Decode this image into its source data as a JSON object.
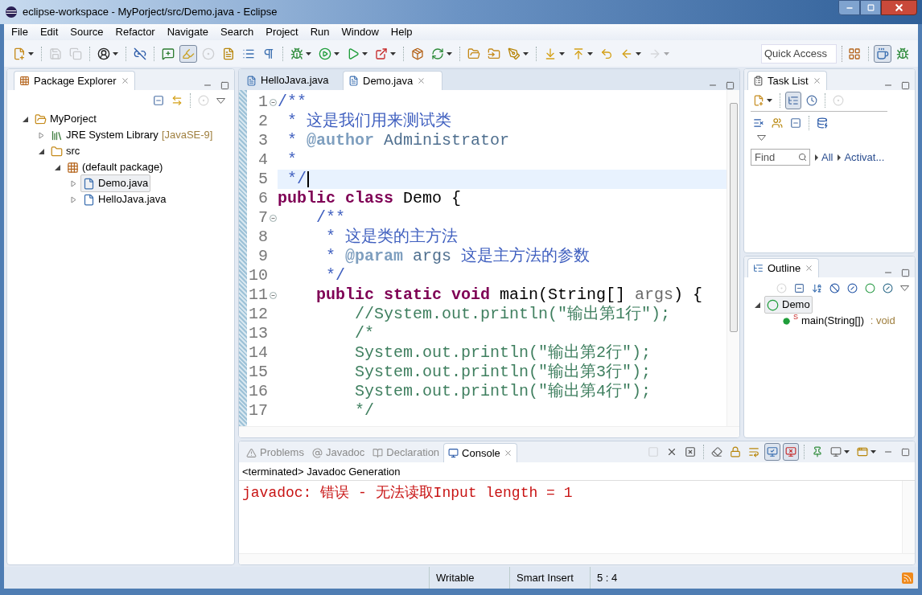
{
  "window": {
    "title": "eclipse-workspace - MyPorject/src/Demo.java - Eclipse"
  },
  "menu": [
    "File",
    "Edit",
    "Source",
    "Refactor",
    "Navigate",
    "Search",
    "Project",
    "Run",
    "Window",
    "Help"
  ],
  "toolbar": [
    {
      "kind": "new",
      "dropdown": true,
      "pressed": false,
      "disabled": false
    },
    {
      "kind": "separator"
    },
    {
      "kind": "save",
      "dropdown": false,
      "pressed": false,
      "disabled": true
    },
    {
      "kind": "save_all",
      "dropdown": false,
      "pressed": false,
      "disabled": true
    },
    {
      "kind": "separator"
    },
    {
      "kind": "person",
      "dropdown": true,
      "pressed": false,
      "disabled": false
    },
    {
      "kind": "separator"
    },
    {
      "kind": "link_off",
      "dropdown": false,
      "pressed": false,
      "disabled": false
    },
    {
      "kind": "separator"
    },
    {
      "kind": "annotation",
      "dropdown": false,
      "pressed": false,
      "disabled": false
    },
    {
      "kind": "highlighter",
      "dropdown": false,
      "pressed": true,
      "disabled": false
    },
    {
      "kind": "dots",
      "dropdown": false,
      "pressed": false,
      "disabled": true
    },
    {
      "kind": "doc",
      "dropdown": false,
      "pressed": false,
      "disabled": false
    },
    {
      "kind": "block",
      "dropdown": false,
      "pressed": false,
      "disabled": false
    },
    {
      "kind": "pilcrow",
      "dropdown": false,
      "pressed": false,
      "disabled": false
    },
    {
      "kind": "separator"
    },
    {
      "kind": "debug",
      "dropdown": true,
      "pressed": false,
      "disabled": false
    },
    {
      "kind": "run",
      "dropdown": true,
      "pressed": false,
      "disabled": false
    },
    {
      "kind": "coverage",
      "dropdown": true,
      "pressed": false,
      "disabled": false
    },
    {
      "kind": "external",
      "dropdown": true,
      "pressed": false,
      "disabled": false
    },
    {
      "kind": "separator"
    },
    {
      "kind": "new_package",
      "dropdown": false,
      "pressed": false,
      "disabled": false
    },
    {
      "kind": "refresh",
      "dropdown": true,
      "pressed": false,
      "disabled": false
    },
    {
      "kind": "separator"
    },
    {
      "kind": "open_folder",
      "dropdown": false,
      "pressed": false,
      "disabled": false
    },
    {
      "kind": "open_type",
      "dropdown": false,
      "pressed": false,
      "disabled": false
    },
    {
      "kind": "pen",
      "dropdown": true,
      "pressed": false,
      "disabled": false
    },
    {
      "kind": "separator"
    },
    {
      "kind": "next",
      "dropdown": true,
      "pressed": false,
      "disabled": false
    },
    {
      "kind": "prev",
      "dropdown": true,
      "pressed": false,
      "disabled": false
    },
    {
      "kind": "last_edit",
      "dropdown": false,
      "pressed": false,
      "disabled": false
    },
    {
      "kind": "back",
      "dropdown": true,
      "pressed": false,
      "disabled": false
    },
    {
      "kind": "forward",
      "dropdown": true,
      "pressed": false,
      "disabled": true
    }
  ],
  "quick_access": {
    "placeholder": "Quick Access"
  },
  "perspectives": [
    {
      "kind": "open_perspective",
      "dropdown": false,
      "pressed": false,
      "disabled": false
    },
    {
      "kind": "separator"
    },
    {
      "kind": "java",
      "dropdown": false,
      "pressed": true,
      "disabled": false
    },
    {
      "kind": "debug",
      "dropdown": false,
      "pressed": false,
      "disabled": false
    }
  ],
  "package_explorer": {
    "title": "Package Explorer",
    "toolbar": [
      {
        "kind": "collapse",
        "dropdown": false,
        "pressed": false,
        "disabled": false
      },
      {
        "kind": "link",
        "dropdown": false,
        "pressed": false,
        "disabled": false
      },
      {
        "kind": "separator"
      },
      {
        "kind": "dots",
        "dropdown": false,
        "pressed": false,
        "disabled": true
      },
      {
        "kind": "view_menu",
        "dropdown": false,
        "pressed": false,
        "disabled": false
      }
    ],
    "tree": [
      {
        "label": "MyPorject",
        "kind": "project",
        "expanded": true,
        "selected": false,
        "children": [
          {
            "label": "JRE System Library",
            "decoration": "[JavaSE-9]",
            "kind": "library",
            "expanded": false,
            "selected": false
          },
          {
            "label": "src",
            "kind": "folder",
            "expanded": true,
            "selected": false,
            "children": [
              {
                "label": "(default package)",
                "kind": "package",
                "expanded": true,
                "selected": false,
                "children": [
                  {
                    "label": "Demo.java",
                    "kind": "file",
                    "expanded": false,
                    "selected": true
                  },
                  {
                    "label": "HelloJava.java",
                    "kind": "file",
                    "expanded": false,
                    "selected": false
                  }
                ]
              }
            ]
          }
        ]
      }
    ]
  },
  "editor": {
    "tabs": [
      {
        "label": "HelloJava.java",
        "selected": false
      },
      {
        "label": "Demo.java",
        "selected": true
      }
    ],
    "lines": [
      {
        "number": "1",
        "fold": true,
        "current": false,
        "tokens": [
          {
            "kind": "comment",
            "text": "/**"
          }
        ]
      },
      {
        "number": "2",
        "fold": false,
        "current": false,
        "tokens": [
          {
            "kind": "comment",
            "text": " * 这是我们用来测试类"
          }
        ]
      },
      {
        "number": "3",
        "fold": false,
        "current": false,
        "tokens": [
          {
            "kind": "comment",
            "text": " * "
          },
          {
            "kind": "tag",
            "text": "@author"
          },
          {
            "kind": "tagvalue",
            "text": " Administrator"
          }
        ]
      },
      {
        "number": "4",
        "fold": false,
        "current": false,
        "tokens": [
          {
            "kind": "comment",
            "text": " *"
          }
        ]
      },
      {
        "number": "5",
        "fold": false,
        "current": true,
        "tokens": [
          {
            "kind": "comment",
            "text": " */"
          }
        ]
      },
      {
        "number": "6",
        "fold": false,
        "current": false,
        "tokens": [
          {
            "kind": "keyword",
            "text": "public"
          },
          {
            "kind": "keyword",
            "text": " class"
          },
          {
            "kind": "plain",
            "text": " Demo {"
          }
        ]
      },
      {
        "number": "7",
        "fold": true,
        "current": false,
        "tokens": [
          {
            "kind": "comment",
            "text": "    /**"
          }
        ]
      },
      {
        "number": "8",
        "fold": false,
        "current": false,
        "tokens": [
          {
            "kind": "comment",
            "text": "     * 这是类的主方法"
          }
        ]
      },
      {
        "number": "9",
        "fold": false,
        "current": false,
        "tokens": [
          {
            "kind": "comment",
            "text": "     * "
          },
          {
            "kind": "tag",
            "text": "@param"
          },
          {
            "kind": "tagvalue",
            "text": " args"
          },
          {
            "kind": "comment",
            "text": " 这是主方法的参数"
          }
        ]
      },
      {
        "number": "10",
        "fold": false,
        "current": false,
        "tokens": [
          {
            "kind": "comment",
            "text": "     */"
          }
        ]
      },
      {
        "number": "11",
        "fold": true,
        "current": false,
        "tokens": [
          {
            "kind": "keyword",
            "text": "    public"
          },
          {
            "kind": "keyword",
            "text": " static"
          },
          {
            "kind": "keyword",
            "text": " void"
          },
          {
            "kind": "plain",
            "text": " main(String[] "
          },
          {
            "kind": "param",
            "text": "args"
          },
          {
            "kind": "plain",
            "text": ") {"
          }
        ]
      },
      {
        "number": "12",
        "fold": false,
        "current": false,
        "tokens": [
          {
            "kind": "linecomment",
            "text": "        //System.out.println(\"输出第1行\");"
          }
        ]
      },
      {
        "number": "13",
        "fold": false,
        "current": false,
        "tokens": [
          {
            "kind": "linecomment",
            "text": "        /*"
          }
        ]
      },
      {
        "number": "14",
        "fold": false,
        "current": false,
        "tokens": [
          {
            "kind": "linecomment",
            "text": "        System.out.println(\"输出第2行\");"
          }
        ]
      },
      {
        "number": "15",
        "fold": false,
        "current": false,
        "tokens": [
          {
            "kind": "linecomment",
            "text": "        System.out.println(\"输出第3行\");"
          }
        ]
      },
      {
        "number": "16",
        "fold": false,
        "current": false,
        "tokens": [
          {
            "kind": "linecomment",
            "text": "        System.out.println(\"输出第4行\");"
          }
        ]
      },
      {
        "number": "17",
        "fold": false,
        "current": false,
        "tokens": [
          {
            "kind": "linecomment",
            "text": "        */"
          }
        ]
      }
    ]
  },
  "task_list": {
    "title": "Task List",
    "toolbar": [
      {
        "kind": "new",
        "dropdown": true,
        "pressed": false,
        "disabled": false
      },
      {
        "kind": "separator"
      },
      {
        "kind": "categorized",
        "dropdown": false,
        "pressed": true,
        "disabled": false
      },
      {
        "kind": "scheduled",
        "dropdown": false,
        "pressed": false,
        "disabled": false
      },
      {
        "kind": "separator"
      },
      {
        "kind": "dots",
        "dropdown": false,
        "pressed": false,
        "disabled": true
      }
    ],
    "toolbar_2": [
      {
        "kind": "hide_completed",
        "dropdown": false,
        "pressed": false,
        "disabled": false
      },
      {
        "kind": "focus",
        "dropdown": false,
        "pressed": false,
        "disabled": false
      },
      {
        "kind": "collapse",
        "dropdown": false,
        "pressed": false,
        "disabled": false
      },
      {
        "kind": "separator"
      },
      {
        "kind": "sync",
        "dropdown": false,
        "pressed": false,
        "disabled": false
      }
    ],
    "find": {
      "placeholder": "Find"
    },
    "filters": [
      "All",
      "Activat..."
    ]
  },
  "outline": {
    "title": "Outline",
    "toolbar": [
      {
        "kind": "dots",
        "dropdown": false,
        "pressed": false,
        "disabled": true
      },
      {
        "kind": "collapse",
        "dropdown": false,
        "pressed": false,
        "disabled": false
      },
      {
        "kind": "sort",
        "dropdown": false,
        "pressed": false,
        "disabled": false
      },
      {
        "kind": "hide_fields",
        "dropdown": false,
        "pressed": false,
        "disabled": false
      },
      {
        "kind": "hide_static",
        "dropdown": false,
        "pressed": false,
        "disabled": false
      },
      {
        "kind": "public",
        "dropdown": false,
        "pressed": false,
        "disabled": false
      },
      {
        "kind": "hide_local",
        "dropdown": false,
        "pressed": false,
        "disabled": false
      },
      {
        "kind": "view_menu",
        "dropdown": false,
        "pressed": false,
        "disabled": false
      }
    ],
    "tree": [
      {
        "label": "Demo",
        "kind": "class",
        "expanded": true,
        "selected": true,
        "children": [
          {
            "label": "main(String[])",
            "modifier": "S",
            "type": " : void",
            "kind": "method",
            "selected": false
          }
        ]
      }
    ]
  },
  "bottom": {
    "tabs": [
      {
        "label": "Problems",
        "kind": "problems",
        "selected": false
      },
      {
        "label": "Javadoc",
        "kind": "javadoc",
        "selected": false
      },
      {
        "label": "Declaration",
        "kind": "declaration",
        "selected": false
      },
      {
        "label": "Console",
        "kind": "console",
        "selected": true
      }
    ],
    "toolbar": [
      {
        "kind": "stop",
        "dropdown": false,
        "pressed": false,
        "disabled": true
      },
      {
        "kind": "remove",
        "dropdown": false,
        "pressed": false,
        "disabled": false
      },
      {
        "kind": "remove_all",
        "dropdown": false,
        "pressed": false,
        "disabled": false
      },
      {
        "kind": "separator"
      },
      {
        "kind": "clear",
        "dropdown": false,
        "pressed": false,
        "disabled": false
      },
      {
        "kind": "scroll_lock",
        "dropdown": false,
        "pressed": false,
        "disabled": false
      },
      {
        "kind": "word_wrap",
        "dropdown": false,
        "pressed": false,
        "disabled": false
      },
      {
        "kind": "show_out",
        "dropdown": false,
        "pressed": true,
        "disabled": false
      },
      {
        "kind": "show_err",
        "dropdown": false,
        "pressed": true,
        "disabled": false
      },
      {
        "kind": "separator"
      },
      {
        "kind": "pin",
        "dropdown": false,
        "pressed": false,
        "disabled": false
      },
      {
        "kind": "display",
        "dropdown": true,
        "pressed": false,
        "disabled": false
      },
      {
        "kind": "open_console",
        "dropdown": true,
        "pressed": false,
        "disabled": false
      }
    ],
    "console_title": "<terminated> Javadoc Generation",
    "output": "javadoc: 错误 - 无法读取Input length = 1"
  },
  "status_bar": [
    "Writable",
    "Smart Insert",
    "5 : 4"
  ]
}
